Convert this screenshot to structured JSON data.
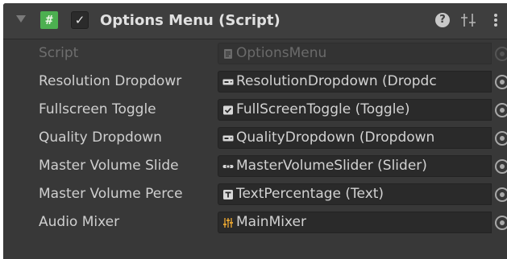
{
  "component": {
    "title": "Options Menu (Script)",
    "script_icon_glyph": "#",
    "enabled_glyph": "✓",
    "help_glyph": "?",
    "icons": {
      "foldout": "foldout-expanded-icon",
      "script": "script-icon",
      "enabled": "checkbox-checked-icon",
      "help": "help-icon",
      "preset": "preset-sliders-icon",
      "menu": "kebab-menu-icon"
    }
  },
  "fields": [
    {
      "label": "Script",
      "value": "OptionsMenu",
      "icon": "script-asset-icon",
      "disabled": true
    },
    {
      "label": "Resolution Dropdowr",
      "value": "ResolutionDropdown (Dropdc",
      "icon": "dropdown-component-icon"
    },
    {
      "label": "Fullscreen Toggle",
      "value": "FullScreenToggle (Toggle)",
      "icon": "toggle-component-icon"
    },
    {
      "label": "Quality Dropdown",
      "value": "QualityDropdown (Dropdown",
      "icon": "dropdown-component-icon"
    },
    {
      "label": "Master Volume Slide",
      "value": "MasterVolumeSlider (Slider)",
      "icon": "slider-component-icon"
    },
    {
      "label": "Master Volume Perce",
      "value": "TextPercentage (Text)",
      "icon": "text-component-icon"
    },
    {
      "label": "Audio Mixer",
      "value": "MainMixer",
      "icon": "audio-mixer-icon"
    }
  ],
  "colors": {
    "panel_bg": "#383838",
    "header_bg": "#3e3e3e",
    "field_bg": "#2a2a2a",
    "script_icon_green": "#4caf50",
    "mixer_icon_orange": "#e0a030",
    "label_text": "#cfcfcf",
    "disabled_text": "#6e6e6e"
  }
}
